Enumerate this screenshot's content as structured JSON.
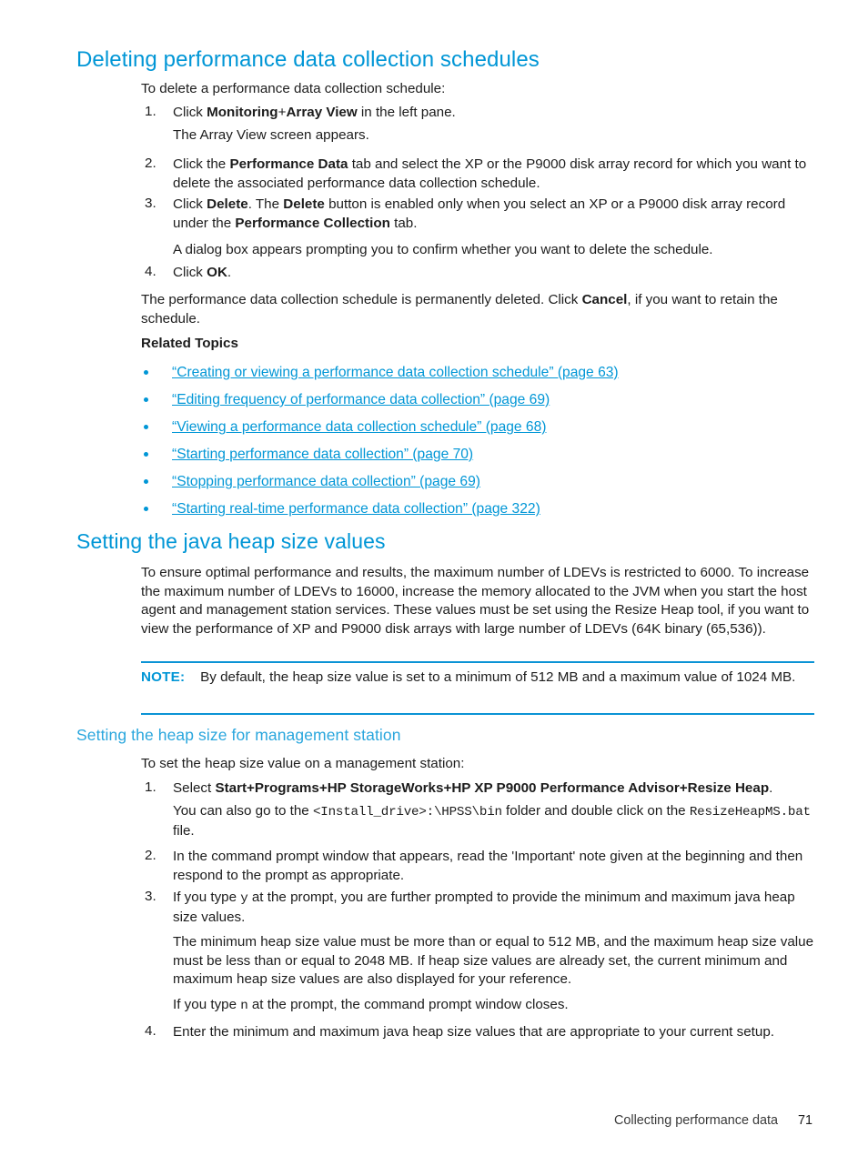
{
  "section1": {
    "heading": "Deleting performance data collection schedules",
    "intro": "To delete a performance data collection schedule:",
    "steps": [
      {
        "num": "1.",
        "parts": [
          {
            "t": "Click ",
            "s": "n"
          },
          {
            "t": "Monitoring",
            "s": "b"
          },
          {
            "t": "+",
            "s": "n"
          },
          {
            "t": "Array View",
            "s": "b"
          },
          {
            "t": " in the left pane.",
            "s": "n"
          }
        ]
      },
      {
        "num": "",
        "parts": [
          {
            "t": "The Array View screen appears.",
            "s": "n"
          }
        ]
      },
      {
        "num": "2.",
        "parts": [
          {
            "t": "Click the ",
            "s": "n"
          },
          {
            "t": "Performance Data",
            "s": "b"
          },
          {
            "t": " tab and select the XP or the P9000 disk array record for which you want to delete the associated performance data collection schedule.",
            "s": "n"
          }
        ]
      },
      {
        "num": "3.",
        "parts": [
          {
            "t": "Click ",
            "s": "n"
          },
          {
            "t": "Delete",
            "s": "b"
          },
          {
            "t": ". The ",
            "s": "n"
          },
          {
            "t": "Delete",
            "s": "b"
          },
          {
            "t": " button is enabled only when you select an XP or a P9000 disk array record under the ",
            "s": "n"
          },
          {
            "t": "Performance Collection",
            "s": "b"
          },
          {
            "t": " tab.",
            "s": "n"
          }
        ]
      },
      {
        "num": "",
        "parts": [
          {
            "t": "A dialog box appears prompting you to confirm whether you want to delete the schedule.",
            "s": "n"
          }
        ]
      },
      {
        "num": "4.",
        "parts": [
          {
            "t": "Click ",
            "s": "n"
          },
          {
            "t": "OK",
            "s": "b"
          },
          {
            "t": ".",
            "s": "n"
          }
        ]
      }
    ],
    "closing": [
      {
        "t": "The performance data collection schedule is permanently deleted. Click ",
        "s": "n"
      },
      {
        "t": "Cancel",
        "s": "b"
      },
      {
        "t": ", if you want to retain the schedule.",
        "s": "n"
      }
    ],
    "related_topics_label": "Related Topics",
    "related_topics": [
      "“Creating or viewing a performance data collection schedule” (page 63)",
      "“Editing frequency of performance data collection” (page 69)",
      "“Viewing a performance data collection schedule” (page 68)",
      "“Starting performance data collection” (page 70)",
      "“Stopping performance data collection” (page 69)",
      "“Starting real-time performance data collection” (page 322)"
    ]
  },
  "section2": {
    "heading": "Setting the java heap size values",
    "paragraph": "To ensure optimal performance and results, the maximum number of LDEVs is restricted to 6000. To increase the maximum number of LDEVs to 16000, increase the memory allocated to the JVM when you start the host agent and management station services. These values must be set using the Resize Heap tool, if you want to view the performance of XP and P9000 disk arrays with large number of LDEVs (64K binary (65,536)).",
    "note": {
      "label": "NOTE:",
      "text": "By default, the heap size value is set to a minimum of 512 MB and a maximum value of 1024 MB."
    },
    "subheading": "Setting the heap size for management station",
    "sub_intro": "To set the heap size value on a management station:",
    "steps": [
      {
        "num": "1.",
        "parts": [
          {
            "t": "Select ",
            "s": "n"
          },
          {
            "t": "Start",
            "s": "b"
          },
          {
            "t": "+",
            "s": "b"
          },
          {
            "t": "Programs",
            "s": "b"
          },
          {
            "t": "+",
            "s": "b"
          },
          {
            "t": "HP StorageWorks",
            "s": "b"
          },
          {
            "t": "+",
            "s": "b"
          },
          {
            "t": "HP XP P9000 Performance Advisor",
            "s": "b"
          },
          {
            "t": "+",
            "s": "b"
          },
          {
            "t": "Resize Heap",
            "s": "b"
          },
          {
            "t": ".",
            "s": "n"
          }
        ]
      },
      {
        "num": "",
        "parts": [
          {
            "t": "You can also go to the ",
            "s": "n"
          },
          {
            "t": "<Install_drive>:\\HPSS\\bin",
            "s": "m"
          },
          {
            "t": " folder and double click on the ",
            "s": "n"
          },
          {
            "t": "ResizeHeapMS.bat",
            "s": "m"
          },
          {
            "t": " file.",
            "s": "n"
          }
        ]
      },
      {
        "num": "2.",
        "parts": [
          {
            "t": "In the command prompt window that appears, read the 'Important' note given at the beginning and then respond to the prompt as appropriate.",
            "s": "n"
          }
        ]
      },
      {
        "num": "3.",
        "parts": [
          {
            "t": "If you type ",
            "s": "n"
          },
          {
            "t": "y",
            "s": "m"
          },
          {
            "t": " at the prompt, you are further prompted to provide the minimum and maximum java heap size values.",
            "s": "n"
          }
        ]
      },
      {
        "num": "",
        "parts": [
          {
            "t": "The minimum heap size value must be more than or equal to 512 MB, and the maximum heap size value must be less than or equal to 2048 MB. If heap size values are already set, the current minimum and maximum heap size values are also displayed for your reference.",
            "s": "n"
          }
        ]
      },
      {
        "num": "",
        "parts": [
          {
            "t": "If you type ",
            "s": "n"
          },
          {
            "t": "n",
            "s": "m"
          },
          {
            "t": " at the prompt, the command prompt window closes.",
            "s": "n"
          }
        ]
      },
      {
        "num": "4.",
        "parts": [
          {
            "t": "Enter the minimum and maximum java heap size values that are appropriate to your current setup.",
            "s": "n"
          }
        ]
      }
    ]
  },
  "footer": {
    "chapter": "Collecting performance data",
    "page_number": "71"
  },
  "colors": {
    "heading_blue": "#0096D6",
    "link_blue": "#0096D6",
    "rule_blue": "#0B93D5",
    "body_text": "#1C1C1C"
  }
}
